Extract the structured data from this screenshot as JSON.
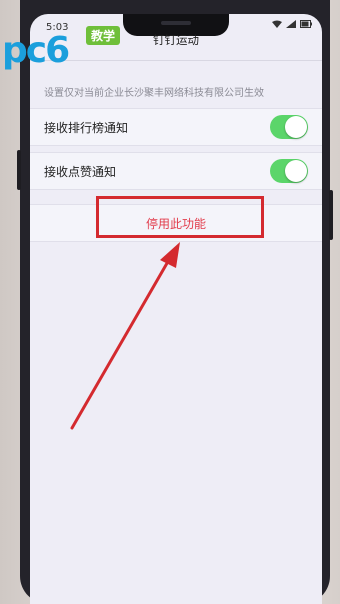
{
  "status_bar": {
    "time": "5:03"
  },
  "logo": {
    "brand_text": "pc6",
    "badge_text": "教学"
  },
  "nav": {
    "title": "钉钉运动"
  },
  "hint_text": "设置仅对当前企业长沙聚丰网络科技有限公司生效",
  "settings": [
    {
      "label": "接收排行榜通知",
      "enabled": true
    },
    {
      "label": "接收点赞通知",
      "enabled": true
    }
  ],
  "stop_button": {
    "label": "停用此功能"
  },
  "colors": {
    "toggle_on": "#5bd56a",
    "stop_text": "#e23b4b",
    "highlight": "#d42a2f",
    "logo_blue": "#1b9fdc",
    "logo_green": "#6fbf3a"
  }
}
